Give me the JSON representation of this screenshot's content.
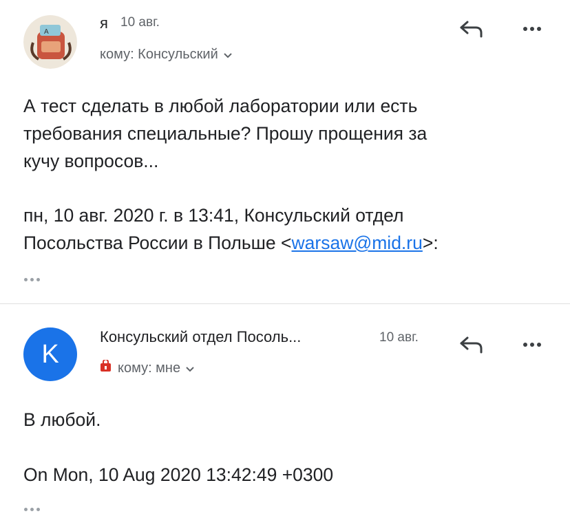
{
  "message1": {
    "sender": "я",
    "date": "10 авг.",
    "to_label": "кому: Консульский",
    "avatar_icon": "backpack-avatar",
    "body_lines": [
      "А тест сделать в любой лаборатории или есть",
      "требования специальные? Прошу прощения за",
      "кучу вопросов..."
    ],
    "quote_line1": "пн, 10 авг. 2020 г. в 13:41, Консульский отдел",
    "quote_line2_prefix": "Посольства России в Польше <",
    "quote_link": "warsaw@mid.ru",
    "quote_line2_suffix": ">:"
  },
  "message2": {
    "avatar_letter": "K",
    "sender": "Консульский отдел Посоль...",
    "date": "10 авг.",
    "to_label": "кому: мне",
    "body": "В любой.",
    "quote": "On Mon, 10 Aug 2020 13:42:49 +0300"
  },
  "colors": {
    "avatar_blue": "#1a73e8",
    "link": "#1a73e8",
    "important_marker": "#d93025"
  }
}
